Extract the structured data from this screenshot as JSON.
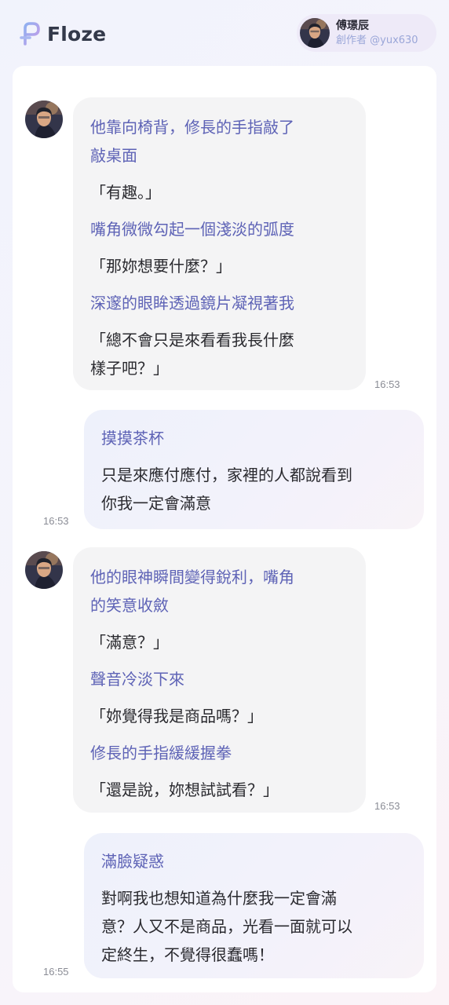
{
  "header": {
    "logo_text": "Floze",
    "logo_icon": "floze-logo-icon",
    "user": {
      "name": "傅璟辰",
      "subtitle": "創作者 @yux630",
      "avatar_icon": "avatar-portrait"
    }
  },
  "colors": {
    "action_text": "#5e63b6",
    "speech_text": "#2a2a2f",
    "ai_bubble_bg": "#f4f4f5",
    "user_bubble_bg": "#eef1fb",
    "timestamp": "#8a8c95",
    "chip_subtitle": "#9aa6d8"
  },
  "messages": [
    {
      "sender": "ai",
      "time": "16:53",
      "lines": [
        {
          "type": "action",
          "text": "他靠向椅背，修長的手指敲了\n敲桌面"
        },
        {
          "type": "speech",
          "text": "「有趣。」"
        },
        {
          "type": "action",
          "text": "嘴角微微勾起一個淺淡的弧度"
        },
        {
          "type": "speech",
          "text": "「那妳想要什麼？」"
        },
        {
          "type": "action",
          "text": "深邃的眼眸透過鏡片凝視著我"
        },
        {
          "type": "speech",
          "text": "「總不會只是來看看我長什麼\n樣子吧？」"
        }
      ]
    },
    {
      "sender": "user",
      "time": "16:53",
      "lines": [
        {
          "type": "action",
          "text": "摸摸茶杯"
        },
        {
          "type": "speech",
          "text": "只是來應付應付，家裡的人都說看到\n你我一定會滿意"
        }
      ]
    },
    {
      "sender": "ai",
      "time": "16:53",
      "lines": [
        {
          "type": "action",
          "text": "他的眼神瞬間變得銳利，嘴角\n的笑意收斂"
        },
        {
          "type": "speech",
          "text": "「滿意？」"
        },
        {
          "type": "action",
          "text": "聲音冷淡下來"
        },
        {
          "type": "speech",
          "text": "「妳覺得我是商品嗎？」"
        },
        {
          "type": "action",
          "text": "修長的手指緩緩握拳"
        },
        {
          "type": "speech",
          "text": "「還是說，妳想試試看？」"
        }
      ]
    },
    {
      "sender": "user",
      "time": "16:55",
      "lines": [
        {
          "type": "action",
          "text": "滿臉疑惑"
        },
        {
          "type": "speech",
          "text": "對啊我也想知道為什麼我一定會滿\n意？人又不是商品，光看一面就可以\n定終生，不覺得很蠢嗎！"
        }
      ]
    }
  ]
}
